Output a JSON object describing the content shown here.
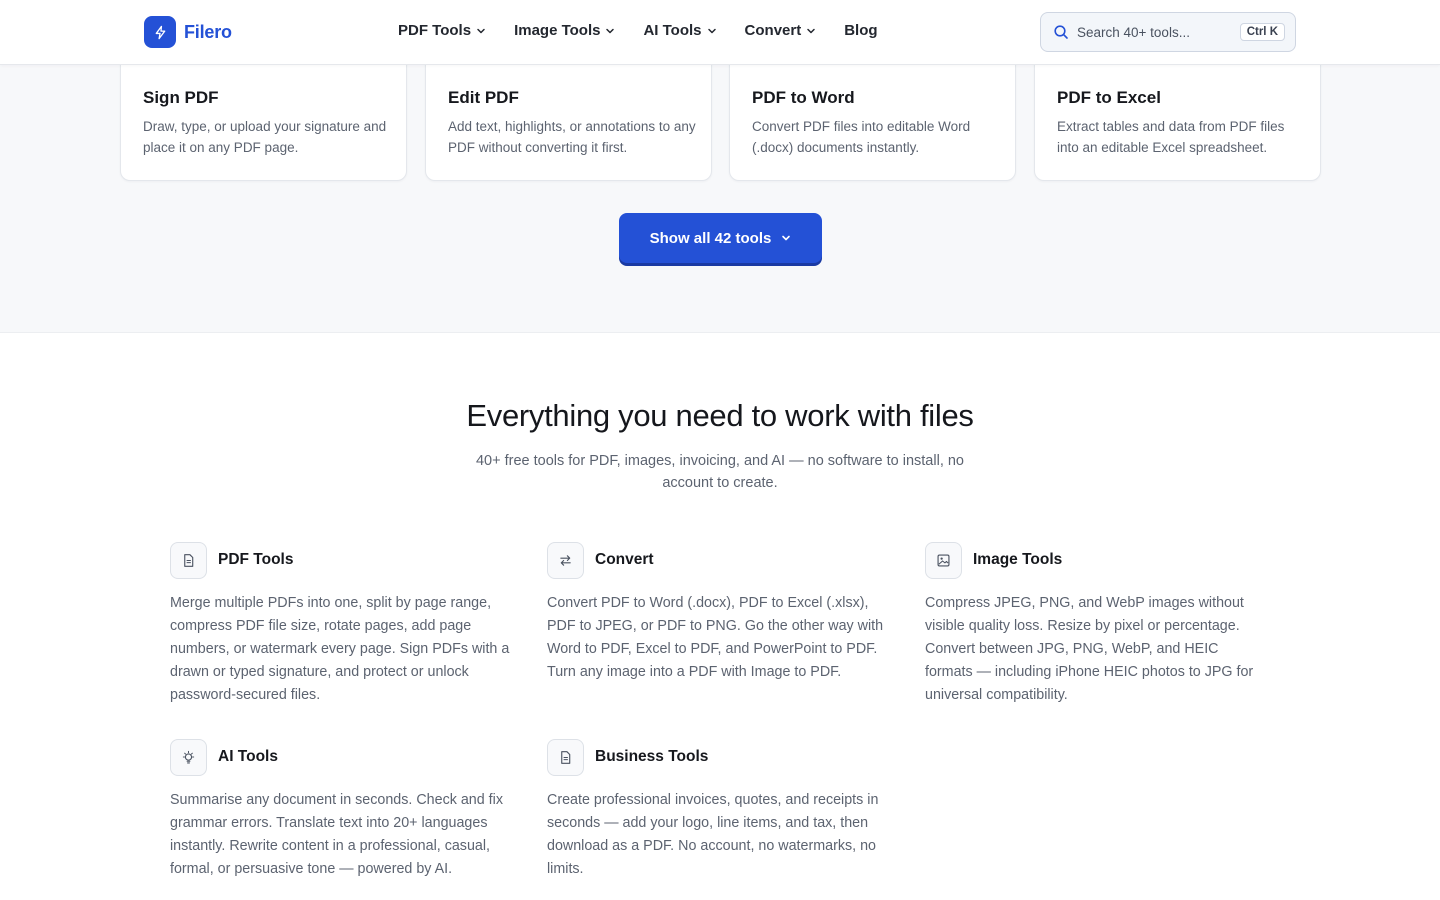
{
  "brand": {
    "name": "Filero",
    "accent": "#2451d6"
  },
  "nav": [
    {
      "label": "PDF Tools",
      "dropdown": true
    },
    {
      "label": "Image Tools",
      "dropdown": true
    },
    {
      "label": "AI Tools",
      "dropdown": true
    },
    {
      "label": "Convert",
      "dropdown": true
    },
    {
      "label": "Blog",
      "dropdown": false
    }
  ],
  "search": {
    "placeholder": "Search 40+ tools...",
    "shortcut": "Ctrl K"
  },
  "tool_cards": [
    {
      "title": "Sign PDF",
      "desc": "Draw, type, or upload your signature and place it on any PDF page."
    },
    {
      "title": "Edit PDF",
      "desc": "Add text, highlights, or annotations to any PDF without converting it first."
    },
    {
      "title": "PDF to Word",
      "desc": "Convert PDF files into editable Word (.docx) documents instantly."
    },
    {
      "title": "PDF to Excel",
      "desc": "Extract tables and data from PDF files into an editable Excel spreadsheet."
    }
  ],
  "show_all_label": "Show all 42 tools",
  "features_section": {
    "title": "Everything you need to work with files",
    "subtitle": "40+ free tools for PDF, images, invoicing, and AI — no software to install, no account to create.",
    "items": [
      {
        "title": "PDF Tools",
        "icon": "document-icon",
        "desc": "Merge multiple PDFs into one, split by page range, compress PDF file size, rotate pages, add page numbers, or watermark every page. Sign PDFs with a drawn or typed signature, and protect or unlock password-secured files."
      },
      {
        "title": "Convert",
        "icon": "swap-arrows-icon",
        "desc": "Convert PDF to Word (.docx), PDF to Excel (.xlsx), PDF to JPEG, or PDF to PNG. Go the other way with Word to PDF, Excel to PDF, and PowerPoint to PDF. Turn any image into a PDF with Image to PDF."
      },
      {
        "title": "Image Tools",
        "icon": "image-icon",
        "desc": "Compress JPEG, PNG, and WebP images without visible quality loss. Resize by pixel or percentage. Convert between JPG, PNG, WebP, and HEIC formats — including iPhone HEIC photos to JPG for universal compatibility."
      },
      {
        "title": "AI Tools",
        "icon": "lightbulb-icon",
        "desc": "Summarise any document in seconds. Check and fix grammar errors. Translate text into 20+ languages instantly. Rewrite content in a professional, casual, formal, or persuasive tone — powered by AI."
      },
      {
        "title": "Business Tools",
        "icon": "document-icon",
        "desc": "Create professional invoices, quotes, and receipts in seconds — add your logo, line items, and tax, then download as a PDF. No account, no watermarks, no limits."
      }
    ]
  }
}
